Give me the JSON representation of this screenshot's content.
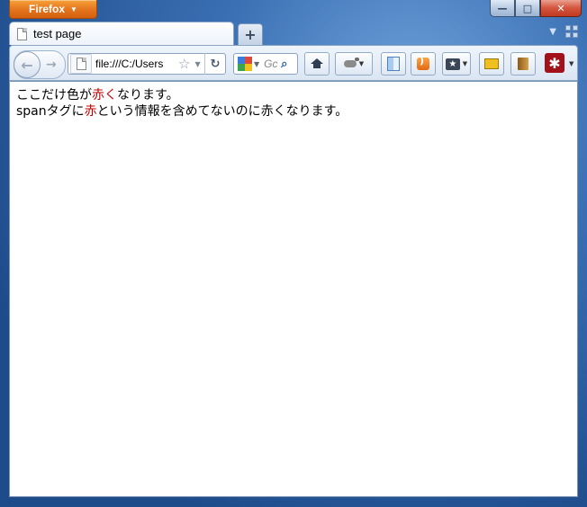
{
  "window": {
    "app_button_label": "Firefox",
    "controls": {
      "minimize": "—",
      "maximize": "□",
      "close": "✕"
    }
  },
  "tabs": [
    {
      "title": "test page",
      "icon": "page-icon",
      "active": true
    }
  ],
  "new_tab_label": "+",
  "toolbar": {
    "url": "file:///C:/Users",
    "search_placeholder": "Gc",
    "reload_glyph": "↻",
    "star_glyph": "☆",
    "search_glyph": "⌕",
    "lastpass_glyph": "✱",
    "icons": [
      "home-icon",
      "firebug-icon",
      "sidebar-icon",
      "rss-icon",
      "bookmark-icon",
      "card-icon",
      "book-icon",
      "lastpass-icon"
    ],
    "back_glyph": "←",
    "forward_glyph": "→"
  },
  "content": {
    "line1": {
      "pre": "ここだけ色が",
      "red": "赤く",
      "post": "なります。"
    },
    "line2": {
      "pre": "spanタグに",
      "red": "赤",
      "post": "という情報を含めてないのに赤くなります。"
    },
    "red_color": "#c00000"
  }
}
